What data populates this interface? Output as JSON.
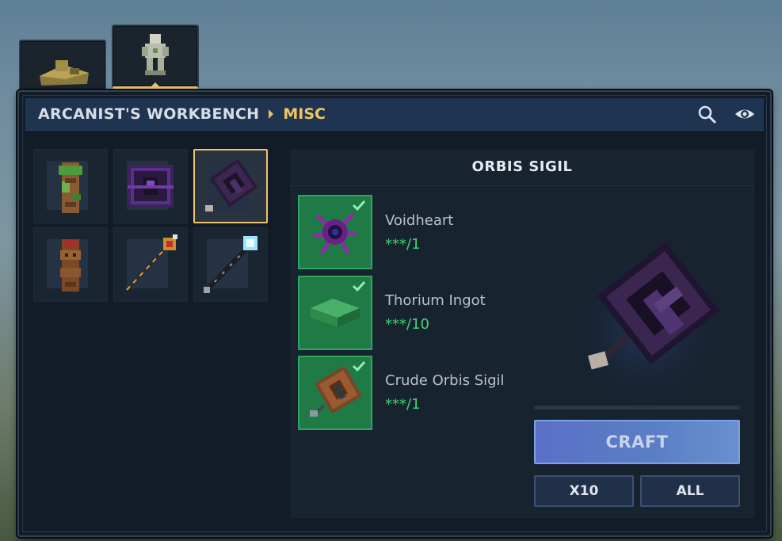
{
  "tabs": [
    {
      "icon": "ruined-altar-icon",
      "selected": false
    },
    {
      "icon": "arcane-statue-icon",
      "selected": true
    }
  ],
  "header": {
    "bench": "ARCANIST'S WORKBENCH",
    "category": "MISC",
    "icons": [
      "search-icon",
      "eye-icon"
    ]
  },
  "items": [
    {
      "icon": "overgrown-totem-icon",
      "selected": false
    },
    {
      "icon": "void-chest-icon",
      "selected": false
    },
    {
      "icon": "orbis-sigil-icon",
      "selected": true
    },
    {
      "icon": "tribal-totem-icon",
      "selected": false
    },
    {
      "icon": "ruby-staff-icon",
      "selected": false
    },
    {
      "icon": "frost-staff-icon",
      "selected": false
    }
  ],
  "recipe": {
    "title": "ORBIS SIGIL",
    "ingredients": [
      {
        "name": "Voidheart",
        "count": "***/1",
        "icon": "voidheart-icon",
        "ready": true
      },
      {
        "name": "Thorium Ingot",
        "count": "***/10",
        "icon": "thorium-ingot-icon",
        "ready": true
      },
      {
        "name": "Crude Orbis Sigil",
        "count": "***/1",
        "icon": "crude-orbis-sigil-icon",
        "ready": true
      }
    ],
    "preview_icon": "orbis-sigil-icon",
    "progress": 0
  },
  "buttons": {
    "craft": "CRAFT",
    "x10": "X10",
    "all": "ALL"
  },
  "colors": {
    "accent_gold": "#e9c46a",
    "ingredient_ready_bg": "#1f7a46",
    "count_green": "#45d27a",
    "craft_button": "#5b6fc7"
  }
}
